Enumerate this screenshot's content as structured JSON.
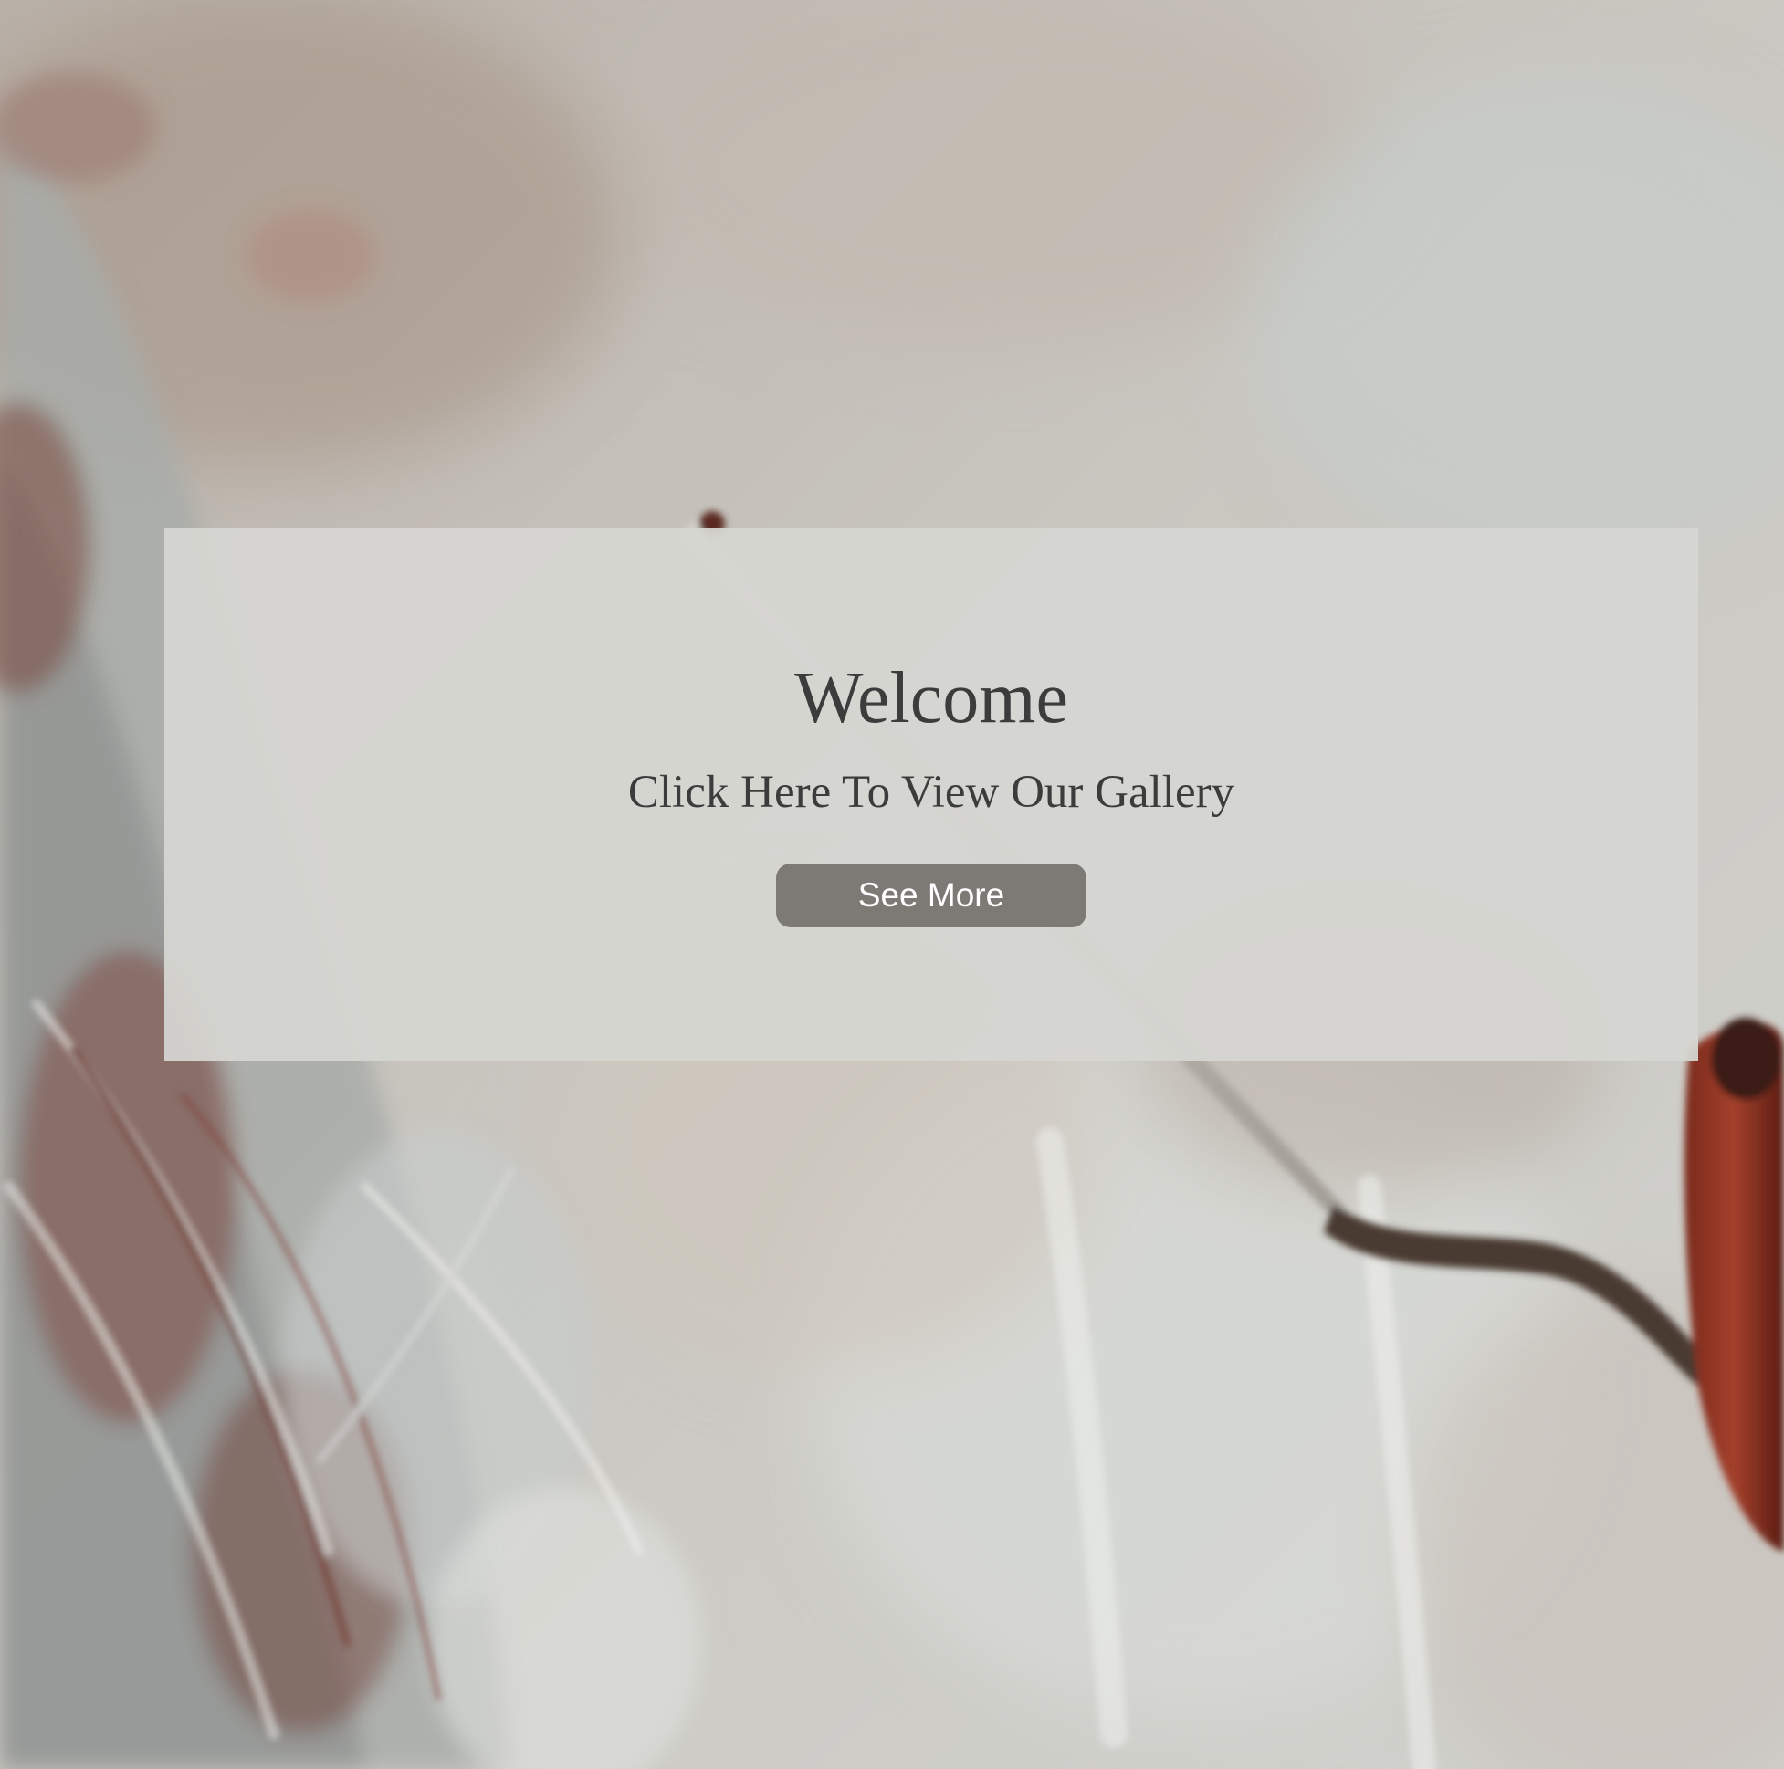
{
  "hero": {
    "background_description_icon": "painted-canvas-with-palette-knife-image",
    "title": "Welcome",
    "subtitle": "Click Here To View Our Gallery",
    "button_label": "See More"
  },
  "colors": {
    "panel_background": "#d6d6d1",
    "text": "#3c3c3c",
    "button_background": "#7d7a76",
    "button_text": "#ffffff"
  }
}
